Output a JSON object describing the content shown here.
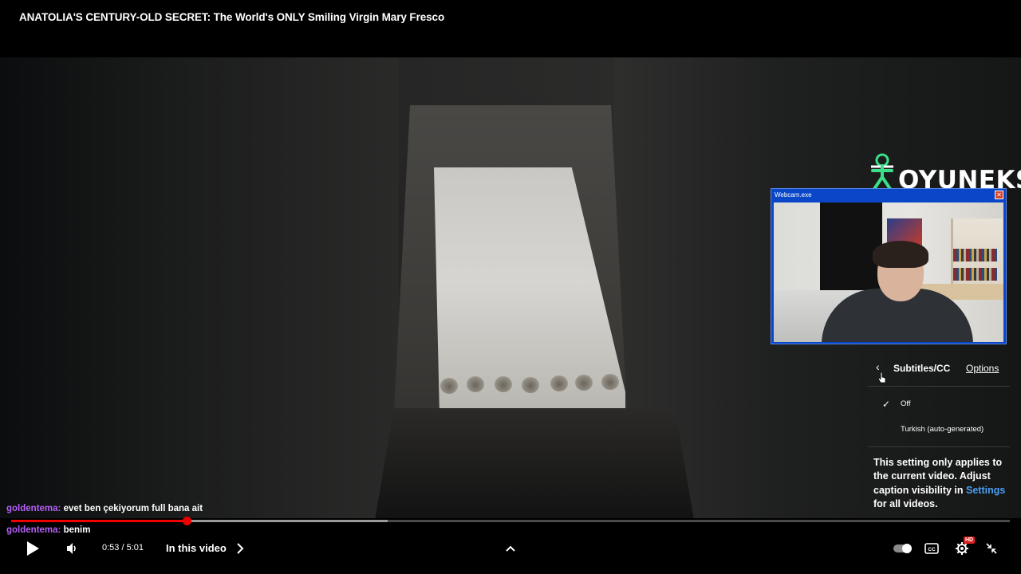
{
  "video": {
    "title": "ANATOLIA'S CENTURY-OLD SECRET: The World's ONLY Smiling Virgin Mary Fresco"
  },
  "overlay": {
    "logo_text": "OYUNEKS",
    "webcam_title": "Webcam.exe",
    "webcam_close": "✕"
  },
  "subtitles_menu": {
    "back_glyph": "‹",
    "header": "Subtitles/CC",
    "options_link": "Options",
    "selected_check": "✓",
    "items": [
      {
        "label": "Off",
        "selected": true
      },
      {
        "label": "Turkish (auto-generated)",
        "selected": false
      }
    ],
    "info_text": "This setting only applies to the current video. Adjust caption visibility in",
    "info_link": "Settings",
    "info_suffix": "for all videos."
  },
  "chat": [
    {
      "user": "goldentema:",
      "message": "evet ben çekiyorum full bana ait"
    },
    {
      "user": "goldentema:",
      "message": "benim"
    }
  ],
  "player": {
    "time_display": "0:53 / 5:01",
    "current_time": "0:53",
    "duration": "5:01",
    "played_fraction": 0.176,
    "buffered_fraction": 0.377,
    "in_this_video_label": "In this video",
    "hd_badge": "HD",
    "colors": {
      "progress_red": "#ee0000",
      "link_blue": "#4a9ff5",
      "chat_user_purple": "#b45ff7",
      "webcam_frame_blue": "#0a46c8"
    },
    "icons": [
      "play-icon",
      "volume-icon",
      "chevron-right-icon",
      "chevron-up-icon",
      "autoplay-toggle",
      "cc-icon",
      "settings-gear-icon",
      "exit-fullscreen-icon"
    ]
  }
}
